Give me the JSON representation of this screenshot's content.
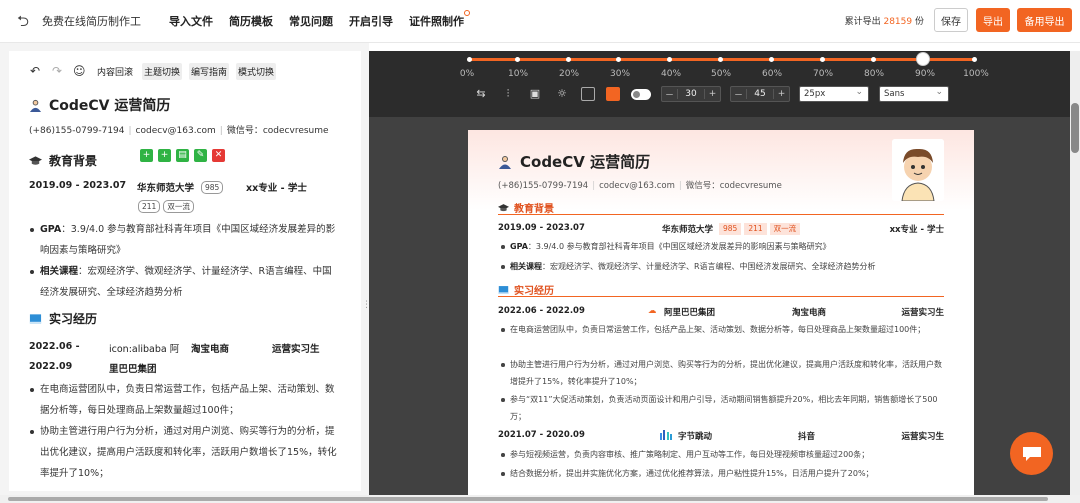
{
  "header": {
    "brand": "免费在线简历制作工",
    "nav": [
      "导入文件",
      "简历模板",
      "常见问题",
      "开启引导",
      "证件照制作"
    ],
    "stat_label": "累计导出",
    "stat_num": "28159",
    "stat_unit": "份",
    "save": "保存",
    "export": "导出",
    "export2": "备用导出"
  },
  "editor": {
    "tools": [
      "内容回滚",
      "主题切换",
      "编写指南",
      "模式切换"
    ],
    "title": "CodeCV 运营简历",
    "contact": [
      "(+86)155-0799-7194",
      "codecv@163.com",
      "微信号：codecvresume"
    ],
    "edu_heading": "教育背景",
    "edu_date": "2019.09 - 2023.07",
    "edu_school": "华东师范大学",
    "edu_tag1": "985",
    "edu_major": "xx专业 - 学士",
    "edu_tag2": "211",
    "edu_tag3": "双一流",
    "gpa_label": "GPA",
    "gpa_text": "：3.9/4.0 参与教育部社科青年项目《中国区域经济发展差异的影响因素与策略研究》",
    "course_label": "相关课程",
    "course_text": "：宏观经济学、微观经济学、计量经济学、R语言编程、中国经济发展研究、全球经济趋势分析",
    "intern_heading": "实习经历",
    "intern_date": "2022.06 -",
    "intern_date2": "2022.09",
    "intern_co": "icon:alibaba 阿",
    "intern_co2": "里巴巴集团",
    "intern_dept": "淘宝电商",
    "intern_role": "运营实习生",
    "b1": "在电商运营团队中，负责日常运营工作，包括产品上架、活动策划、数据分析等，每日处理商品上架数量超过100件；",
    "b2": "协助主管进行用户行为分析，通过对用户浏览、购买等行为的分析，提出优化建议，提高用户活跃度和转化率，活跃用户数增长了15%，转化率提升了10%；"
  },
  "zoom": {
    "marks": [
      "0%",
      "10%",
      "20%",
      "30%",
      "40%",
      "50%",
      "60%",
      "70%",
      "80%",
      "90%",
      "100%"
    ],
    "value_percent": 90
  },
  "controls": {
    "step1": "30",
    "step2": "45",
    "font_size": "25px",
    "font": "Sans",
    "minus": "－",
    "plus": "+"
  },
  "preview": {
    "title": "CodeCV 运营简历",
    "contact": [
      "(+86)155-0799-7194",
      "codecv@163.com",
      "微信号：codecvresume"
    ],
    "edu_heading": "教育背景",
    "edu_date": "2019.09 - 2023.07",
    "edu_school": "华东师范大学",
    "edu_tags": [
      "985",
      "211",
      "双一流"
    ],
    "edu_major": "xx专业 - 学士",
    "gpa_label": "GPA",
    "gpa_text": "：3.9/4.0 参与教育部社科青年项目《中国区域经济发展差异的影响因素与策略研究》",
    "course_label": "相关课程",
    "course_text": "：宏观经济学、微观经济学、计量经济学、R语言编程、中国经济发展研究、全球经济趋势分析",
    "intern_heading": "实习经历",
    "j1_date": "2022.06 - 2022.09",
    "j1_co": "阿里巴巴集团",
    "j1_dept": "淘宝电商",
    "j1_role": "运营实习生",
    "j1_b1": "在电商运营团队中，负责日常运营工作，包括产品上架、活动策划、数据分析等，每日处理商品上架数量超过100件；",
    "j1_b2": "协助主管进行用户行为分析，通过对用户浏览、购买等行为的分析，提出优化建议，提高用户活跃度和转化率，活跃用户数增提升了15%，转化率提升了10%；",
    "j1_b3": "参与“双11”大促活动策划，负责活动页面设计和用户引导，活动期间销售额提升20%，相比去年同期，销售额增长了500万；",
    "j2_date": "2021.07 - 2020.09",
    "j2_co": "字节跳动",
    "j2_dept": "抖音",
    "j2_role": "运营实习生",
    "j2_b1": "参与短视频运营，负责内容审核、推广策略制定、用户互动等工作，每日处理视频审核量超过200条；",
    "j2_b2": "结合数据分析，提出并实施优化方案，通过优化推荐算法，用户粘性提升15%，日活用户提升了20%；"
  },
  "colors": {
    "accent": "#f26522"
  }
}
